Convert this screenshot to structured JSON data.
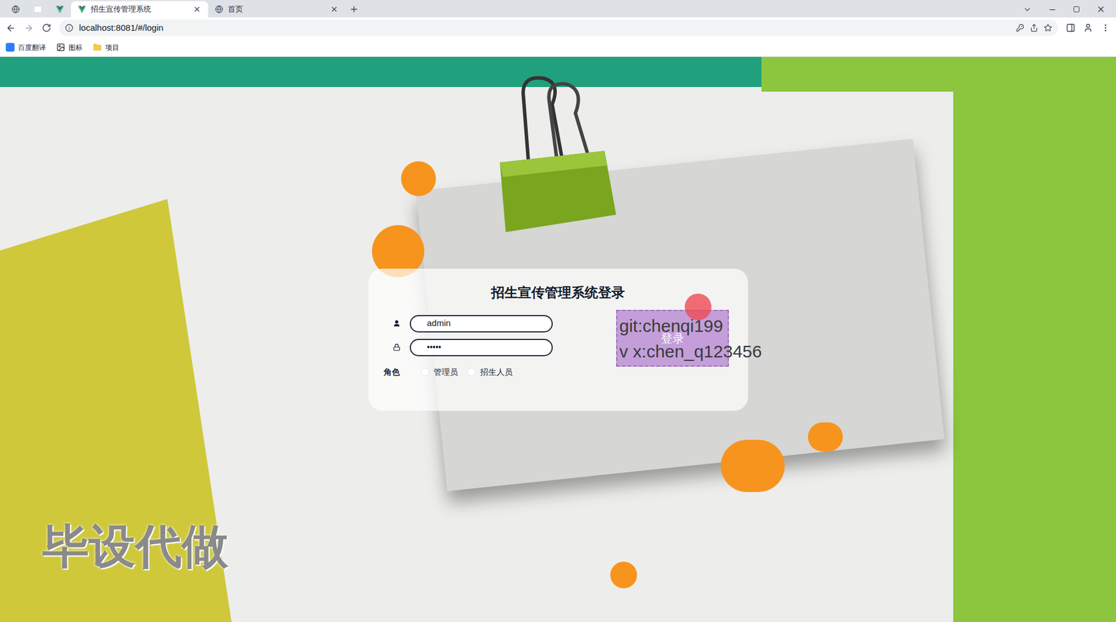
{
  "browser": {
    "tabs": [
      {
        "label": "",
        "kind": "pinned-globe",
        "selected": false
      },
      {
        "label": "",
        "kind": "pinned-blank",
        "selected": false
      },
      {
        "label": "",
        "kind": "pinned-vue",
        "selected": false
      },
      {
        "label": "招生宣传管理系统",
        "kind": "full-vue",
        "selected": true
      },
      {
        "label": "首页",
        "kind": "full-globe",
        "selected": false
      }
    ],
    "address": "localhost:8081/#/login",
    "bookmarks": [
      {
        "label": "百度翻译",
        "kind": "translate"
      },
      {
        "label": "图标",
        "kind": "image"
      },
      {
        "label": "项目",
        "kind": "folder"
      }
    ]
  },
  "login": {
    "title": "招生宣传管理系统登录",
    "username": "admin",
    "password": "•••••",
    "role_label": "角色",
    "roles": [
      {
        "label": "管理员",
        "selected": false
      },
      {
        "label": "招生人员",
        "selected": false
      }
    ],
    "button": "登录"
  },
  "overlays": {
    "contact": [
      "git:chenqi199",
      "v x:chen_q123456"
    ],
    "watermark": "毕设代做"
  }
}
